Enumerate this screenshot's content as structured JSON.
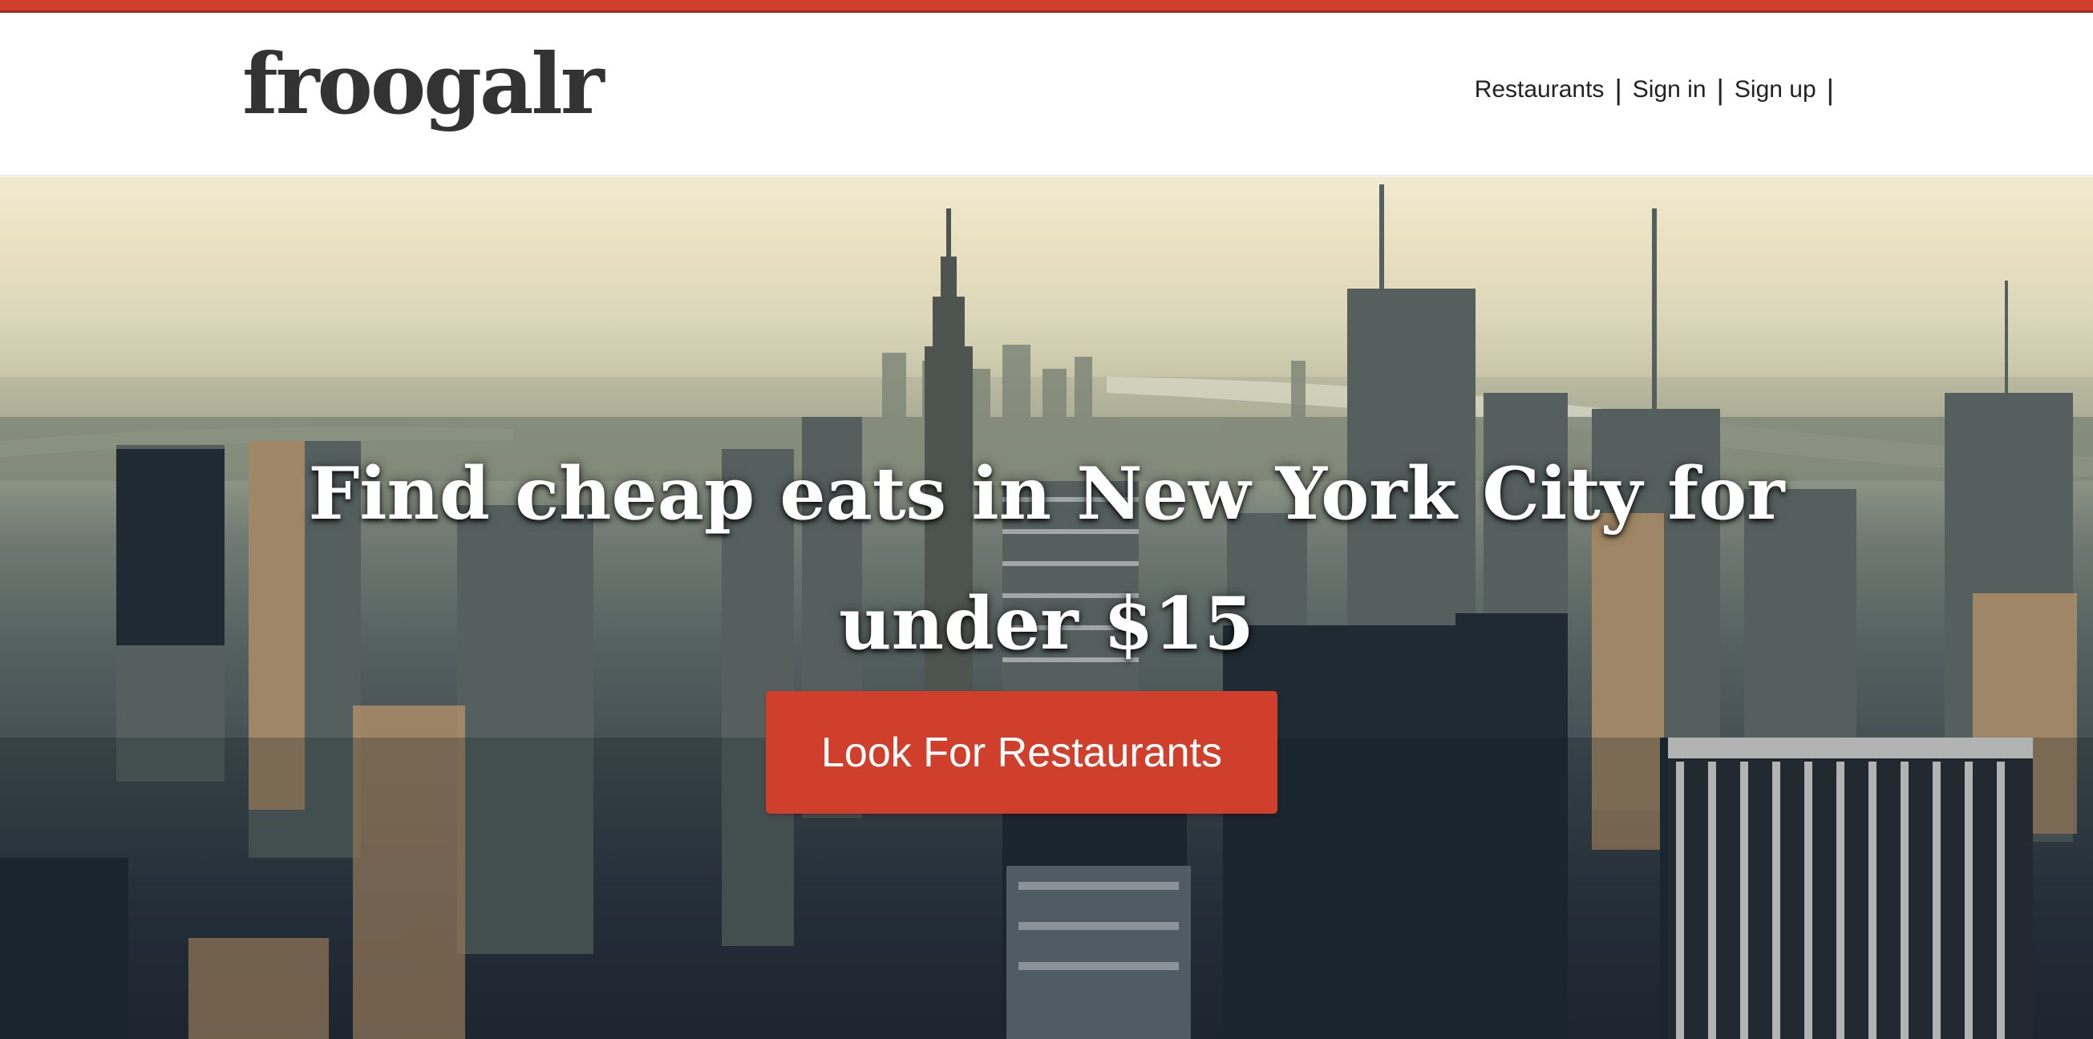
{
  "header": {
    "logo_text": "froogalr",
    "nav": {
      "restaurants": "Restaurants",
      "sign_in": "Sign in",
      "sign_up": "Sign up",
      "separator": "|"
    }
  },
  "hero": {
    "title": "Find cheap eats in New York City for under $15",
    "cta_label": "Look For Restaurants"
  },
  "colors": {
    "accent": "#d03f2c",
    "logo_text": "#333333",
    "header_bg": "#ffffff"
  }
}
